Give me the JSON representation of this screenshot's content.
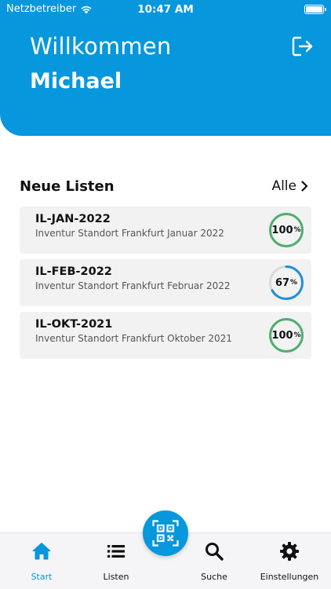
{
  "status_bar": {
    "carrier": "Netzbetreiber",
    "time": "10:47 AM"
  },
  "header": {
    "greeting": "Willkommen",
    "user_name": "Michael",
    "logout_icon": "logout-icon"
  },
  "section": {
    "title": "Neue Listen",
    "all_label": "Alle"
  },
  "lists": [
    {
      "code": "IL-JAN-2022",
      "description": "Inventur Standort Frankfurt Januar 2022",
      "progress": 100,
      "progress_text": "100",
      "color": "#4caf6e"
    },
    {
      "code": "IL-FEB-2022",
      "description": "Inventur Standort Frankfurt Februar 2022",
      "progress": 67,
      "progress_text": "67",
      "color": "#1e8fd6"
    },
    {
      "code": "IL-OKT-2021",
      "description": "Inventur Standort Frankfurt Oktober 2021",
      "progress": 100,
      "progress_text": "100",
      "color": "#4caf6e"
    }
  ],
  "percent_sign": "%",
  "tabbar": {
    "items": [
      {
        "label": "Start",
        "icon": "home-icon",
        "active": true
      },
      {
        "label": "Listen",
        "icon": "list-icon",
        "active": false
      },
      {
        "label": "Suche",
        "icon": "search-icon",
        "active": false
      },
      {
        "label": "Einstellungen",
        "icon": "gear-icon",
        "active": false
      }
    ],
    "scan_icon": "qr-scan-icon"
  },
  "colors": {
    "primary": "#0797dd",
    "ring_track": "#d9d9d9",
    "complete": "#4caf6e",
    "in_progress": "#1e8fd6"
  }
}
